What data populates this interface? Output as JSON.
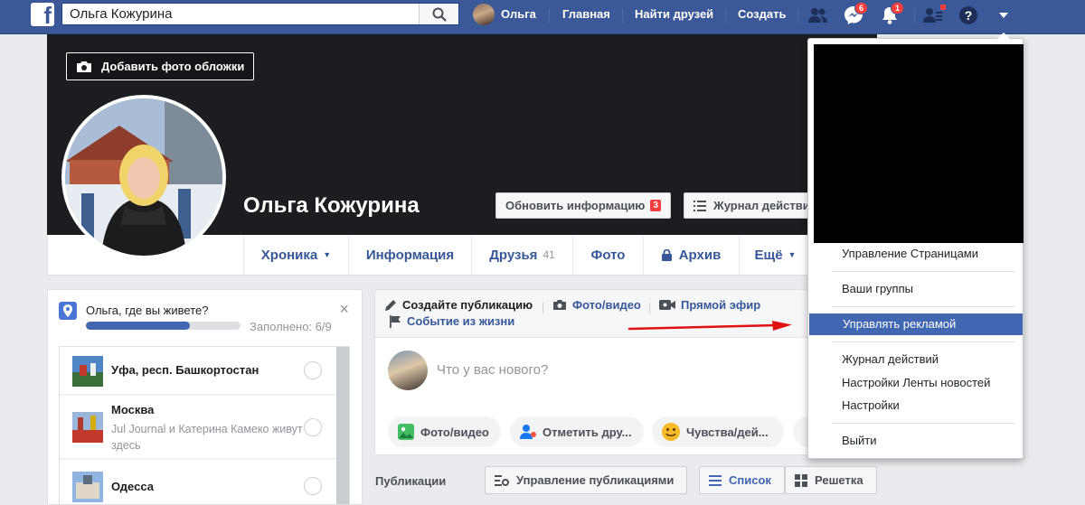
{
  "topbar": {
    "search_value": "Ольга Кожурина",
    "user_name": "Ольга",
    "links": [
      "Главная",
      "Найти друзей",
      "Создать"
    ],
    "messenger_badge": "6",
    "notifications_badge": "1"
  },
  "cover": {
    "add_cover_label": "Добавить фото обложки",
    "profile_name": "Ольга Кожурина",
    "update_info_label": "Обновить информацию",
    "update_info_count": "3",
    "activity_log_label": "Журнал действий"
  },
  "tabs": [
    {
      "label": "Хроника",
      "caret": "▼"
    },
    {
      "label": "Информация"
    },
    {
      "label": "Друзья",
      "count": "41"
    },
    {
      "label": "Фото"
    },
    {
      "label": "Архив"
    },
    {
      "label": "Ещё",
      "caret": "▼"
    }
  ],
  "location_card": {
    "title": "Ольга, где вы живете?",
    "progress_fraction": 0.67,
    "completed_label": "Заполнено: 6/9",
    "close": "×",
    "suggestions": [
      {
        "name": "Уфа, респ. Башкортостан"
      },
      {
        "name": "Москва",
        "sub": "Jul Journal и Катерина Камеко живут здесь"
      },
      {
        "name": "Одесса"
      }
    ]
  },
  "composer": {
    "create_post": "Создайте публикацию",
    "photo_video": "Фото/видео",
    "live": "Прямой эфир",
    "life_event": "Событие из жизни",
    "placeholder": "Что у вас нового?",
    "actions": [
      "Фото/видео",
      "Отметить дру...",
      "Чувства/дей..."
    ]
  },
  "publications": {
    "label": "Публикации",
    "manage_label": "Управление публикациями",
    "list_label": "Список",
    "grid_label": "Решетка"
  },
  "dropdown": {
    "items": [
      "Управление Страницами",
      "Ваши группы",
      "Управлять рекламой",
      "Журнал действий",
      "Настройки Ленты новостей",
      "Настройки",
      "Выйти"
    ]
  },
  "colors": {
    "brand_blue": "#3b5998",
    "link_blue": "#365899",
    "menu_highlight": "#4267b2",
    "arrow_red": "#e01010"
  }
}
